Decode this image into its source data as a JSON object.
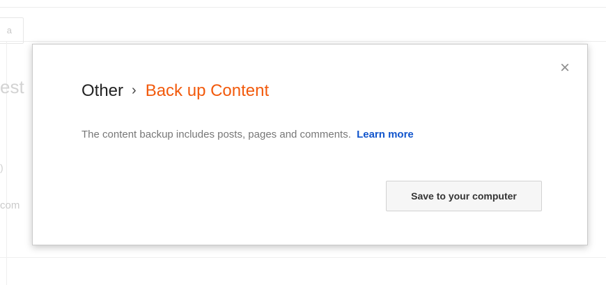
{
  "background": {
    "toolbar_button_label": "a",
    "heading_fragment": "est",
    "small_fragment": ")",
    "mid_fragment": "com"
  },
  "dialog": {
    "breadcrumb": {
      "parent": "Other",
      "separator": "›",
      "current": "Back up Content"
    },
    "close_label": "×",
    "description": "The content backup includes posts, pages and comments.",
    "learn_more_label": "Learn more",
    "save_button_label": "Save to your computer"
  },
  "colors": {
    "accent": "#f25a0c",
    "link": "#1155cc"
  }
}
